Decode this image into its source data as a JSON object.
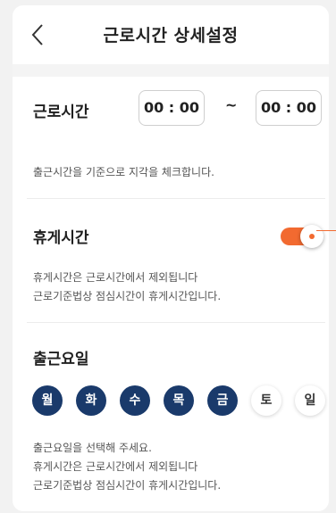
{
  "header": {
    "title": "근로시간 상세설정"
  },
  "work_time": {
    "label": "근로시간",
    "start": "00 : 00",
    "separator": "~",
    "end": "00 : 00",
    "help": "출근시간을 기준으로 지각을 체크합니다."
  },
  "break_time": {
    "label": "휴게시간",
    "enabled": true,
    "help_lines": [
      "휴게시간은 근로시간에서 제외됩니다",
      "근로기준법상 점심시간이 휴게시간입니다."
    ]
  },
  "work_days": {
    "label": "출근요일",
    "days": [
      {
        "label": "월",
        "selected": true
      },
      {
        "label": "화",
        "selected": true
      },
      {
        "label": "수",
        "selected": true
      },
      {
        "label": "목",
        "selected": true
      },
      {
        "label": "금",
        "selected": true
      },
      {
        "label": "토",
        "selected": false
      },
      {
        "label": "일",
        "selected": false
      }
    ],
    "help_lines": [
      "출근요일을 선택해 주세요.",
      "휴게시간은 근로시간에서 제외됩니다",
      "근로기준법상 점심시간이 휴게시간입니다."
    ]
  },
  "colors": {
    "accent": "#f26a30",
    "selected_day": "#1a3a6b"
  }
}
